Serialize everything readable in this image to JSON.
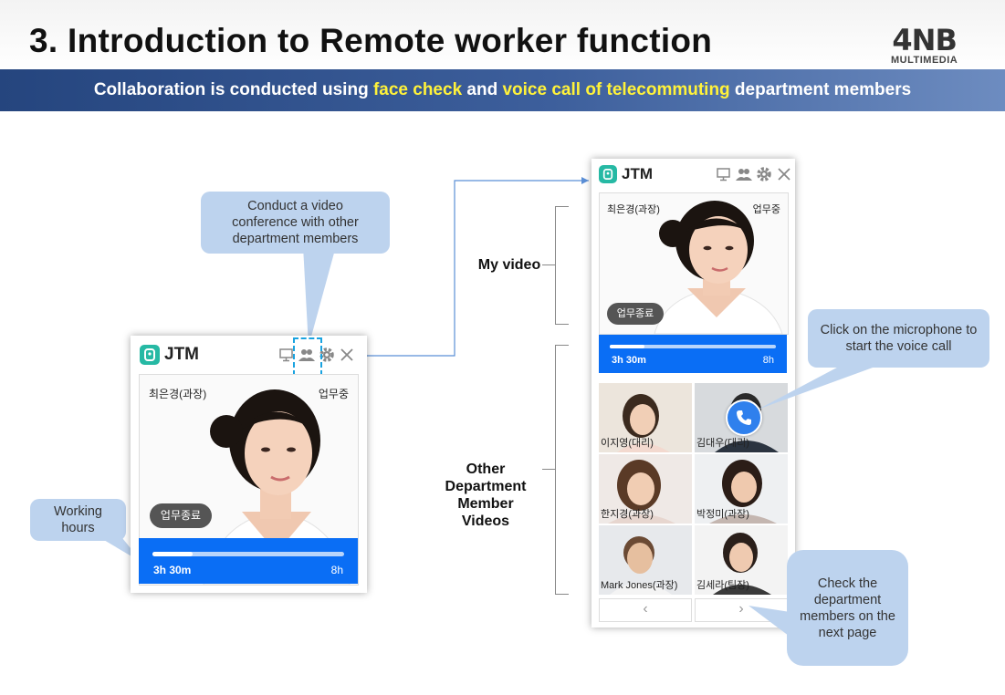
{
  "slide": {
    "title": "3. Introduction to Remote worker function",
    "logo_main": "4NB",
    "logo_sub": "MULTIMEDIA"
  },
  "banner": {
    "part1": "Collaboration is conducted using ",
    "highlight1": "face check",
    "part2": " and ",
    "highlight2": "voice call of telecommuting",
    "part3": " department members"
  },
  "callouts": {
    "video_conference": "Conduct a video conference with other department members",
    "working_hours": "Working hours",
    "microphone": "Click on the microphone to start the voice call",
    "next_page": "Check the department members on the next page"
  },
  "labels": {
    "my_video": "My video",
    "other_videos": "Other Department Member Videos"
  },
  "app": {
    "name": "JTM",
    "user_name": "최은경(과장)",
    "status": "업무중",
    "end_work_button": "업무종료",
    "elapsed": "3h 30m",
    "target": "8h",
    "progress_fraction": 0.21
  },
  "members": [
    {
      "name": "이지영(대리)"
    },
    {
      "name": "김대우(대리)"
    },
    {
      "name": "한지경(과장)"
    },
    {
      "name": "박정미(과장)"
    },
    {
      "name": "Mark Jones(과장)"
    },
    {
      "name": "김세라(팀장)"
    }
  ],
  "pager": {
    "prev": "‹",
    "next": "›"
  },
  "colors": {
    "banner_highlight": "#fff23a",
    "time_bar": "#0a6ef5",
    "callout_bg": "#bdd3ee",
    "brand_green": "#26b9a4"
  }
}
